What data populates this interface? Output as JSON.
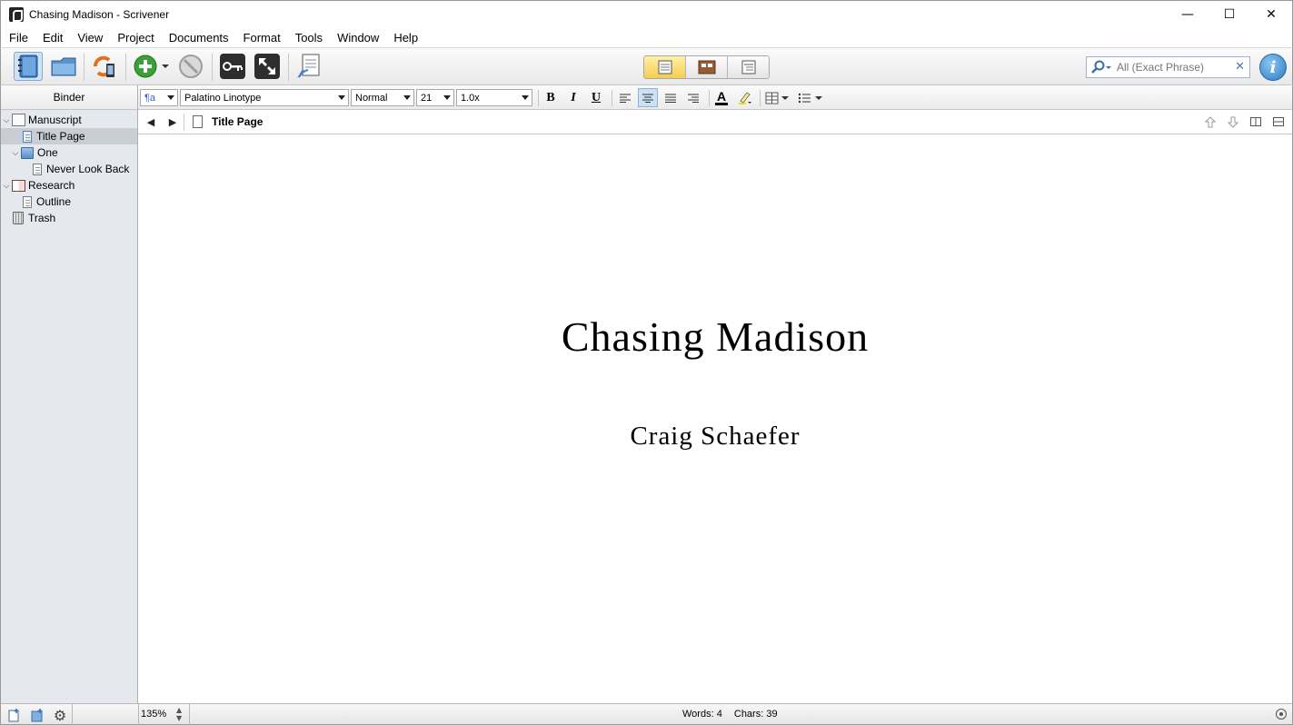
{
  "window": {
    "title": "Chasing Madison - Scrivener",
    "minimize": "—",
    "maximize": "☐",
    "close": "✕"
  },
  "menu": {
    "items": [
      "File",
      "Edit",
      "View",
      "Project",
      "Documents",
      "Format",
      "Tools",
      "Window",
      "Help"
    ]
  },
  "toolbar": {
    "icons": [
      "binder-icon",
      "collections-icon",
      "sync-icon",
      "add-icon",
      "delete-icon",
      "keywords-icon",
      "fullscreen-icon",
      "quick-reference-icon"
    ],
    "view_modes": [
      "document-view",
      "corkboard-view",
      "outliner-view"
    ],
    "active_view": "document-view",
    "search": {
      "placeholder": "All (Exact Phrase)",
      "clear": "✕"
    },
    "info_label": "i"
  },
  "binder": {
    "header": "Binder",
    "items": [
      {
        "label": "Manuscript",
        "level": 0,
        "expanded": true,
        "icon": "manuscript-icon"
      },
      {
        "label": "Title Page",
        "level": 1,
        "selected": true,
        "icon": "document-icon"
      },
      {
        "label": "One",
        "level": 1,
        "expanded": true,
        "icon": "folder-icon"
      },
      {
        "label": "Never Look Back",
        "level": 2,
        "icon": "document-icon"
      },
      {
        "label": "Research",
        "level": 0,
        "expanded": true,
        "icon": "research-icon"
      },
      {
        "label": "Outline",
        "level": 1,
        "icon": "document-icon"
      },
      {
        "label": "Trash",
        "level": 0,
        "icon": "trash-icon"
      }
    ]
  },
  "format_bar": {
    "style_glyph": "¶a",
    "font": "Palatino Linotype",
    "typeface": "Normal",
    "size": "21",
    "line_spacing": "1.0x",
    "bold": "B",
    "italic": "I",
    "underline": "U",
    "text_color_glyph": "A",
    "active_alignment": "center"
  },
  "nav": {
    "document_title": "Title Page",
    "back": "◀",
    "forward": "▶"
  },
  "document": {
    "title": "Chasing Madison",
    "author": "Craig Schaefer"
  },
  "status": {
    "zoom": "135%",
    "words_label": "Words: 4",
    "chars_label": "Chars: 39"
  },
  "colors": {
    "active_view": "#f5cc4f",
    "binder_bg": "#e5e9ee",
    "selection": "#c9ced4",
    "add_button": "#3aa13a",
    "info_button": "#2a7ac4"
  }
}
